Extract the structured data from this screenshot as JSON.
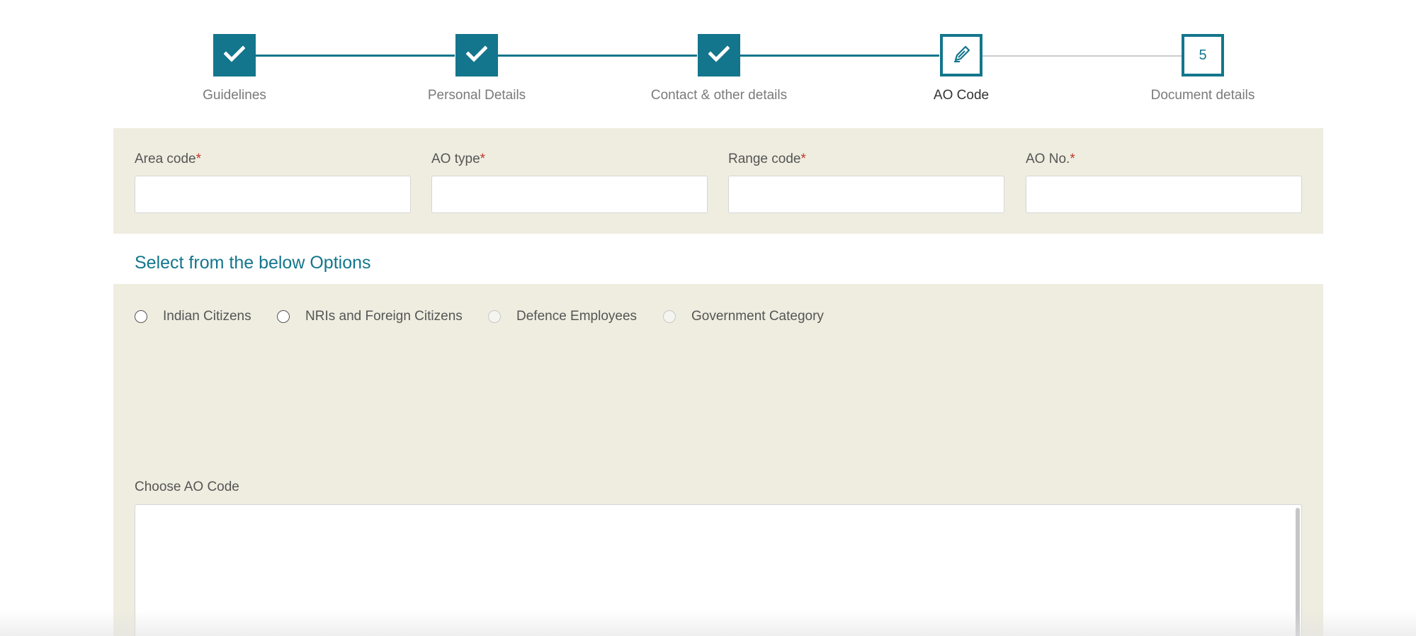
{
  "stepper": {
    "steps": [
      {
        "label": "Guidelines",
        "state": "done",
        "icon": "check-icon"
      },
      {
        "label": "Personal Details",
        "state": "done",
        "icon": "check-icon"
      },
      {
        "label": "Contact & other details",
        "state": "done",
        "icon": "check-icon"
      },
      {
        "label": "AO Code",
        "state": "active",
        "icon": "pencil-icon"
      },
      {
        "label": "Document details",
        "state": "pending",
        "number": "5"
      }
    ]
  },
  "fields": [
    {
      "label": "Area code",
      "required_mark": "*",
      "value": ""
    },
    {
      "label": "AO type",
      "required_mark": "*",
      "value": ""
    },
    {
      "label": "Range code",
      "required_mark": "*",
      "value": ""
    },
    {
      "label": "AO No.",
      "required_mark": "*",
      "value": ""
    }
  ],
  "options": {
    "title": "Select from the below Options",
    "radios": [
      {
        "label": "Indian Citizens",
        "enabled": true,
        "selected": false
      },
      {
        "label": "NRIs and Foreign Citizens",
        "enabled": true,
        "selected": false
      },
      {
        "label": "Defence Employees",
        "enabled": false,
        "selected": false
      },
      {
        "label": "Government Category",
        "enabled": false,
        "selected": false
      }
    ],
    "choose_label": "Choose AO Code",
    "choose_value": ""
  },
  "colors": {
    "accent": "#13768c",
    "panel_background": "#efede0",
    "required": "#c0392b",
    "pending_line": "#cccccc"
  }
}
